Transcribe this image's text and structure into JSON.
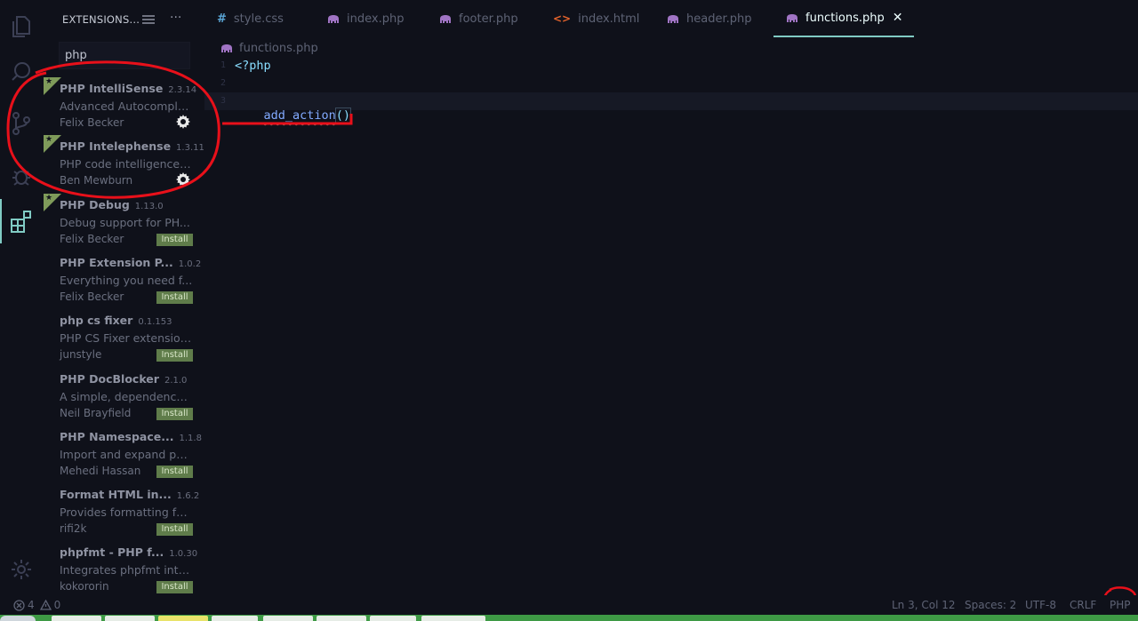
{
  "sidebar": {
    "title": "EXTENSIONS...",
    "search_value": "php",
    "extensions": [
      {
        "name": "PHP IntelliSense",
        "version": "2.3.14",
        "description": "Advanced Autocomple...",
        "publisher": "Felix Becker",
        "state": "installed",
        "recommended": true
      },
      {
        "name": "PHP Intelephense",
        "version": "1.3.11",
        "description": "PHP code intelligence f...",
        "publisher": "Ben Mewburn",
        "state": "installed",
        "recommended": true
      },
      {
        "name": "PHP Debug",
        "version": "1.13.0",
        "description": "Debug support for PH...",
        "publisher": "Felix Becker",
        "state": "install",
        "recommended": true
      },
      {
        "name": "PHP Extension P...",
        "version": "1.0.2",
        "description": "Everything you need f...",
        "publisher": "Felix Becker",
        "state": "install",
        "recommended": false
      },
      {
        "name": "php cs fixer",
        "version": "0.1.153",
        "description": "PHP CS Fixer extension...",
        "publisher": "junstyle",
        "state": "install",
        "recommended": false
      },
      {
        "name": "PHP DocBlocker",
        "version": "2.1.0",
        "description": "A simple, dependency ...",
        "publisher": "Neil Brayfield",
        "state": "install",
        "recommended": false
      },
      {
        "name": "PHP Namespace...",
        "version": "1.1.8",
        "description": "Import and expand ph...",
        "publisher": "Mehedi Hassan",
        "state": "install",
        "recommended": false
      },
      {
        "name": "Format HTML in...",
        "version": "1.6.2",
        "description": "Provides formatting fo...",
        "publisher": "rifi2k",
        "state": "install",
        "recommended": false
      },
      {
        "name": "phpfmt - PHP f...",
        "version": "1.0.30",
        "description": "Integrates phpfmt into...",
        "publisher": "kokororin",
        "state": "install",
        "recommended": false
      }
    ],
    "install_label": "Install"
  },
  "tabs": [
    {
      "label": "style.css",
      "icon": "css-hash-icon",
      "active": false
    },
    {
      "label": "index.php",
      "icon": "php-elephant-icon",
      "active": false
    },
    {
      "label": "footer.php",
      "icon": "php-elephant-icon",
      "active": false
    },
    {
      "label": "index.html",
      "icon": "html-brackets-icon",
      "active": false
    },
    {
      "label": "header.php",
      "icon": "php-elephant-icon",
      "active": false
    },
    {
      "label": "functions.php",
      "icon": "php-elephant-icon",
      "active": true
    }
  ],
  "breadcrumb": "functions.php",
  "editor": {
    "line_numbers": [
      "1",
      "2",
      "3"
    ],
    "lines": [
      "<?php",
      "",
      "add_action()"
    ],
    "code_fn": "add_action",
    "code_parens": "()"
  },
  "status": {
    "errors": "4",
    "warnings": "0",
    "cursor": "Ln 3, Col 12",
    "spaces": "Spaces: 2",
    "encoding": "UTF-8",
    "eol": "CRLF",
    "language": "PHP"
  },
  "colors": {
    "background": "#0f111a",
    "accent": "#80cbc4",
    "install_badge": "#5f7c4a",
    "annotation_red": "#e8101a"
  }
}
